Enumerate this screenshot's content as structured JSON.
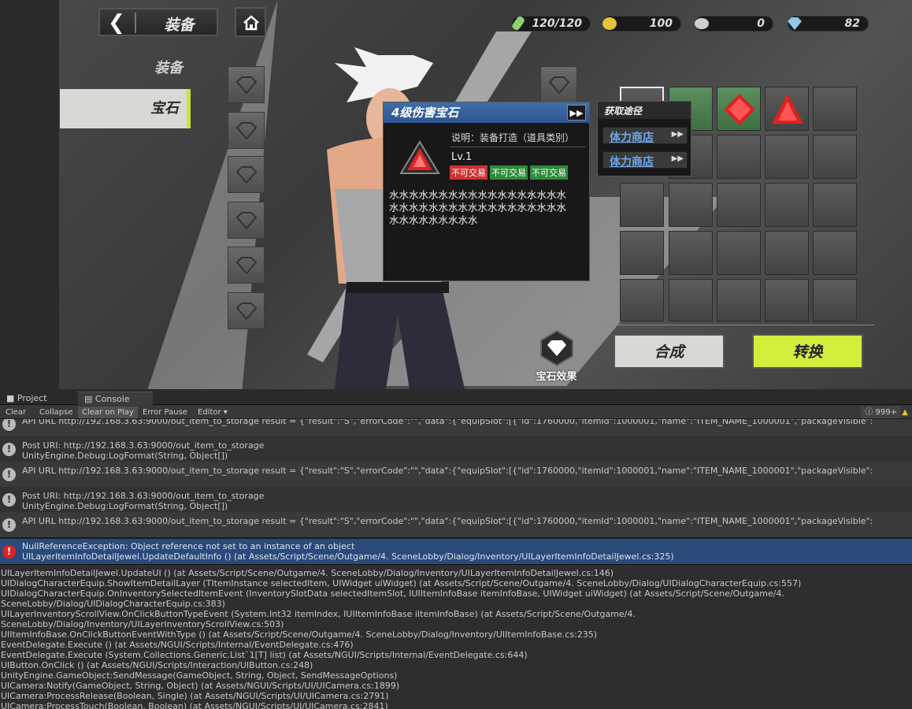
{
  "game": {
    "header_title": "装备",
    "resources": [
      {
        "name": "stamina",
        "value": "120/120"
      },
      {
        "name": "gold",
        "value": "100"
      },
      {
        "name": "silver",
        "value": "0"
      },
      {
        "name": "diamond",
        "value": "82"
      }
    ],
    "side_tabs": {
      "equip": "装备",
      "gem": "宝石"
    },
    "gem_effect_label": "宝石效果",
    "buttons": {
      "combine": "合成",
      "convert": "转换"
    },
    "tooltip": {
      "title": "4级伤害宝石",
      "description": "说明：装备打造（道具类别）",
      "level": "Lv.1",
      "tags": [
        "不可交易",
        "不可交易",
        "不可交易"
      ],
      "body_line1": "水水水水水水水水水水水水水水水水水水",
      "body_line2": "水水水水水水水水水水水水水水水水水水",
      "body_line3": "水水水水水水水水水"
    },
    "source": {
      "title": "获取途径",
      "items": [
        "体力商店",
        "体力商店"
      ]
    },
    "colors": {
      "accent": "#d6ec3c",
      "tooltip_header": "#3f6ea8",
      "link": "#6ea7e8"
    }
  },
  "console": {
    "tabs": {
      "project": "Project",
      "console": "Console"
    },
    "toolbar": {
      "clear": "Clear",
      "collapse": "Collapse",
      "clear_on_play": "Clear on Play",
      "error_pause": "Error Pause",
      "editor": "Editor ▾",
      "count": "999+"
    },
    "logs": [
      {
        "line1": "API URL http://192.168.3.63:9000/out_item_to_storage result = {\"result\":\"S\",\"errorCode\":\"\",\"data\":{\"equipSlot\":[{\"id\":1760000,\"itemId\":1000001,\"name\":\"ITEM_NAME_1000001\",\"packageVisible\":",
        "line2": ""
      },
      {
        "line1": "Post URI: http://192.168.3.63:9000/out_item_to_storage",
        "line2": "UnityEngine.Debug:LogFormat(String, Object[])"
      },
      {
        "line1": "API URL http://192.168.3.63:9000/out_item_to_storage result = {\"result\":\"S\",\"errorCode\":\"\",\"data\":{\"equipSlot\":[{\"id\":1760000,\"itemId\":1000001,\"name\":\"ITEM_NAME_1000001\",\"packageVisible\":",
        "line2": ""
      },
      {
        "line1": "Post URI: http://192.168.3.63:9000/out_item_to_storage",
        "line2": "UnityEngine.Debug:LogFormat(String, Object[])"
      },
      {
        "line1": "API URL http://192.168.3.63:9000/out_item_to_storage result = {\"result\":\"S\",\"errorCode\":\"\",\"data\":{\"equipSlot\":[{\"id\":1760000,\"itemId\":1000001,\"name\":\"ITEM_NAME_1000001\",\"packageVisible\":",
        "line2": ""
      },
      {
        "line1": "NullReferenceException: Object reference not set to an instance of an object",
        "line2": "UILayerItemInfoDetailJewel.UpdateDefaultInfo () (at Assets/Script/Scene/Outgame/4. SceneLobby/Dialog/Inventory/UILayerItemInfoDetailJewel.cs:325)"
      }
    ],
    "stack": [
      "UILayerItemInfoDetailJewel.UpdateUI () (at Assets/Script/Scene/Outgame/4. SceneLobby/Dialog/Inventory/UILayerItemInfoDetailJewel.cs:146)",
      "UIDialogCharacterEquip.ShowItemDetailLayer (TItemInstance selectedItem, UIWidget uiWidget) (at Assets/Script/Scene/Outgame/4. SceneLobby/Dialog/UIDialogCharacterEquip.cs:557)",
      "UIDialogCharacterEquip.OnInventorySelectedItemEvent (InventorySlotData selectedItemSlot, IUIItemInfoBase itemInfoBase, UIWidget uiWidget) (at Assets/Script/Scene/Outgame/4.",
      "SceneLobby/Dialog/UIDialogCharacterEquip.cs:383)",
      "UILayerInventoryScrollView.OnClickButtonTypeEvent (System.Int32 itemIndex, IUIItemInfoBase iItemInfoBase) (at Assets/Script/Scene/Outgame/4.",
      "SceneLobby/Dialog/Inventory/UILayerInventoryScrollView.cs:503)",
      "UIItemInfoBase.OnClickButtonEventWithType () (at Assets/Script/Scene/Outgame/4. SceneLobby/Dialog/Inventory/UIItemInfoBase.cs:235)",
      "EventDelegate.Execute () (at Assets/NGUI/Scripts/Internal/EventDelegate.cs:476)",
      "EventDelegate.Execute (System.Collections.Generic.List`1[T] list) (at Assets/NGUI/Scripts/Internal/EventDelegate.cs:644)",
      "UIButton.OnClick () (at Assets/NGUI/Scripts/Interaction/UIButton.cs:248)",
      "UnityEngine.GameObject:SendMessage(GameObject, String, Object, SendMessageOptions)",
      "UICamera:Notify(GameObject, String, Object) (at Assets/NGUI/Scripts/UI/UICamera.cs:1899)",
      "UICamera:ProcessRelease(Boolean, Single) (at Assets/NGUI/Scripts/UI/UICamera.cs:2791)",
      "UICamera:ProcessTouch(Boolean, Boolean) (at Assets/NGUI/Scripts/UI/UICamera.cs:2841)"
    ]
  }
}
